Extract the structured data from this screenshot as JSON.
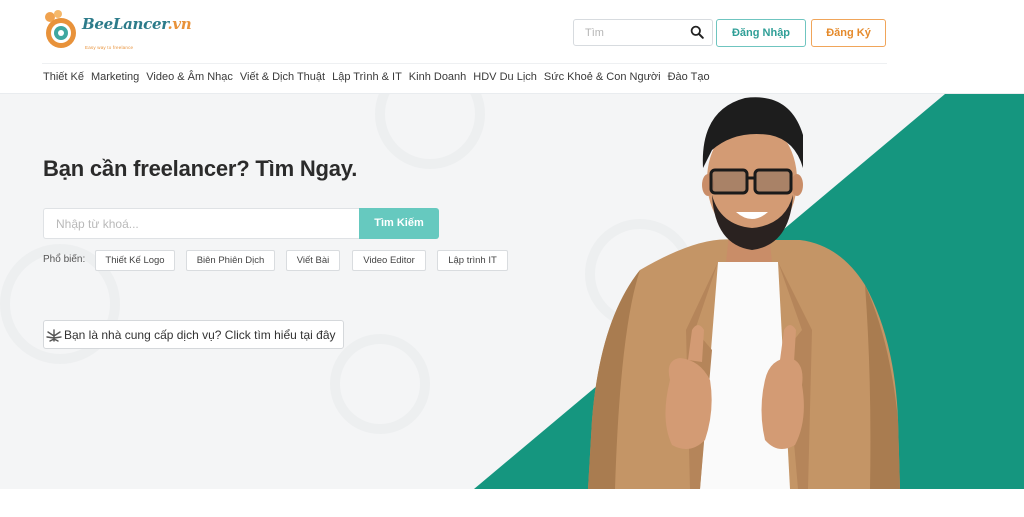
{
  "brand": {
    "name": "BeeLancer",
    "suffix": ".vn",
    "tagline": "Easy way to freelance"
  },
  "header": {
    "search_placeholder": "Tìm",
    "login_label": "Đăng Nhập",
    "register_label": "Đăng Ký"
  },
  "nav": {
    "items": [
      "Thiết Kế",
      "Marketing",
      "Video & Âm Nhạc",
      "Viết & Dịch Thuật",
      "Lập Trình & IT",
      "Kinh Doanh",
      "HDV Du Lịch",
      "Sức Khoẻ & Con Người",
      "Đào Tạo"
    ]
  },
  "hero": {
    "title": "Bạn cần freelancer? Tìm Ngay.",
    "search_placeholder": "Nhập từ khoá...",
    "search_button": "Tìm Kiếm",
    "popular_label": "Phổ biến:",
    "popular_tags": [
      "Thiết Kế Logo",
      "Biên Phiên Dịch",
      "Viết Bài",
      "Video Editor",
      "Lập trình IT"
    ],
    "provider_text": "Bạn là nhà cung cấp dịch vụ? Click tìm hiểu tại đây"
  },
  "colors": {
    "teal": "#15967f",
    "teal_button": "#66c9bf",
    "orange": "#e58a2b",
    "hero_bg": "#f4f5f6"
  },
  "icons": {
    "search": "magnifier-icon",
    "provider": "cannabis-leaf-icon",
    "logo": "bee-logo-icon"
  }
}
